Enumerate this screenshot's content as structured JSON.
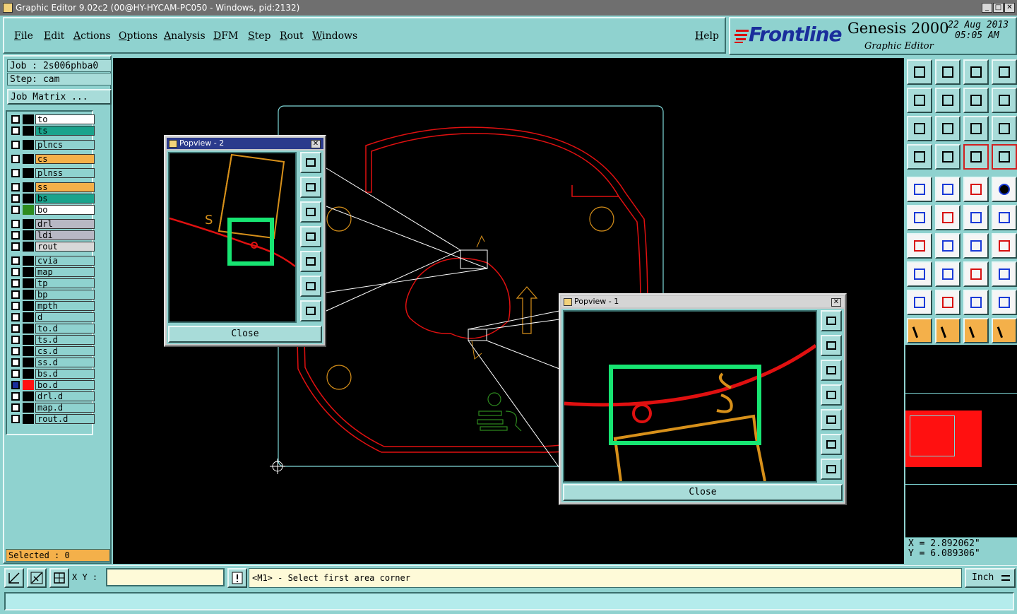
{
  "window": {
    "title": "Graphic Editor 9.02c2 (00@HY-HYCAM-PC050 - Windows, pid:2132)",
    "minimize": "_",
    "maximize": "□",
    "close": "✕"
  },
  "menu": {
    "items": [
      "File",
      "Edit",
      "Actions",
      "Options",
      "Analysis",
      "DFM",
      "Step",
      "Rout",
      "Windows"
    ],
    "help": "Help"
  },
  "brand": {
    "logo": "Frontline",
    "product": "Genesis 2000",
    "subtitle": "Graphic Editor",
    "date": "22 Aug 2013",
    "time": "05:05 AM"
  },
  "job": {
    "job_label": "Job : 2s006phba0",
    "step_label": "Step: cam",
    "matrix_button": "Job Matrix ..."
  },
  "layers": [
    {
      "name": "to",
      "color": "#ffffff",
      "swatch": "#000000"
    },
    {
      "name": "ts",
      "color": "#1aa38c",
      "swatch": "#000000"
    },
    {
      "name": "plncs",
      "color": "#8fd2cf",
      "swatch": "#000000"
    },
    {
      "name": "cs",
      "color": "#f4b04a",
      "swatch": "#000000"
    },
    {
      "name": "plnss",
      "color": "#8fd2cf",
      "swatch": "#000000"
    },
    {
      "name": "ss",
      "color": "#f4b04a",
      "swatch": "#000000"
    },
    {
      "name": "bs",
      "color": "#1aa38c",
      "swatch": "#000000"
    },
    {
      "name": "bo",
      "color": "#ffffff",
      "swatch": "#2e8b1f"
    },
    {
      "name": "drl",
      "color": "#b8b8c4",
      "swatch": "#000000"
    },
    {
      "name": "ldi",
      "color": "#b8b8c4",
      "swatch": "#000000"
    },
    {
      "name": "rout",
      "color": "#d8d8d8",
      "swatch": "#000000"
    },
    {
      "name": "cvia",
      "color": "#8fd2cf",
      "swatch": "#000000"
    },
    {
      "name": "map",
      "color": "#8fd2cf",
      "swatch": "#000000"
    },
    {
      "name": "tp",
      "color": "#8fd2cf",
      "swatch": "#000000"
    },
    {
      "name": "bp",
      "color": "#8fd2cf",
      "swatch": "#000000"
    },
    {
      "name": "mpth",
      "color": "#8fd2cf",
      "swatch": "#000000"
    },
    {
      "name": "d",
      "color": "#8fd2cf",
      "swatch": "#000000"
    },
    {
      "name": "to.d",
      "color": "#8fd2cf",
      "swatch": "#000000"
    },
    {
      "name": "ts.d",
      "color": "#8fd2cf",
      "swatch": "#000000"
    },
    {
      "name": "cs.d",
      "color": "#8fd2cf",
      "swatch": "#000000"
    },
    {
      "name": "ss.d",
      "color": "#8fd2cf",
      "swatch": "#000000"
    },
    {
      "name": "bs.d",
      "color": "#8fd2cf",
      "swatch": "#000000"
    },
    {
      "name": "bo.d",
      "color": "#8fd2cf",
      "swatch": "#ff1010"
    },
    {
      "name": "drl.d",
      "color": "#8fd2cf",
      "swatch": "#000000"
    },
    {
      "name": "map.d",
      "color": "#8fd2cf",
      "swatch": "#000000"
    },
    {
      "name": "rout.d",
      "color": "#8fd2cf",
      "swatch": "#000000"
    }
  ],
  "selected": "Selected : 0",
  "popview2": {
    "title": "Popview - 2",
    "close_label": "Close"
  },
  "popview1": {
    "title": "Popview - 1",
    "close_label": "Close"
  },
  "coords": {
    "x": "X = 2.892062\"",
    "y": "Y = 6.089306\""
  },
  "bottom": {
    "xy_label": "X Y :",
    "xy_value": "",
    "prompt": "<M1> - Select first area corner",
    "units": "Inch",
    "status": ""
  },
  "colors": {
    "panel": "#8fd2cf",
    "outline": "#e01010",
    "profile": "#7fd8d8",
    "copper": "#d7901a",
    "highlight": "#17e572",
    "silkscreen": "#2e8b1f"
  }
}
